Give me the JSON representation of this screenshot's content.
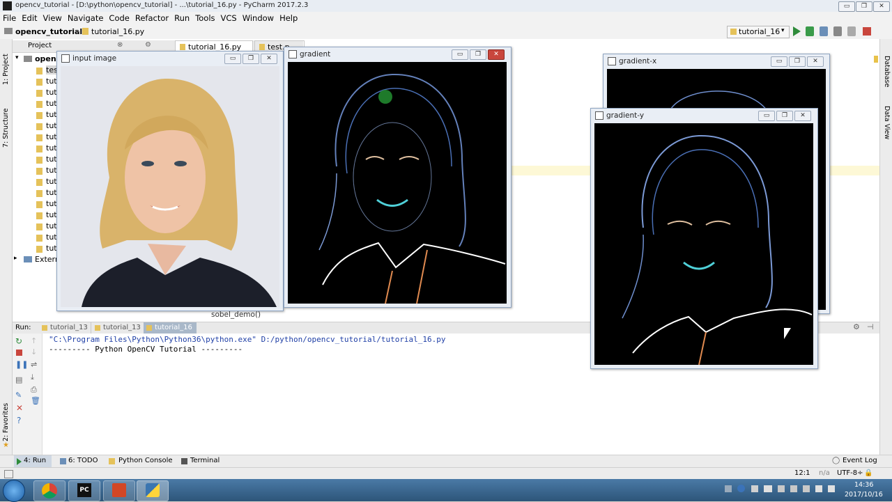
{
  "window": {
    "title": "opencv_tutorial - [D:\\python\\opencv_tutorial] - ...\\tutorial_16.py - PyCharm 2017.2.3",
    "min": "▭",
    "max": "❐",
    "close": "✕"
  },
  "menu": [
    "File",
    "Edit",
    "View",
    "Navigate",
    "Code",
    "Refactor",
    "Run",
    "Tools",
    "VCS",
    "Window",
    "Help"
  ],
  "nav": {
    "project": "opencv_tutorial",
    "file": "tutorial_16.py",
    "run_config": "tutorial_16"
  },
  "side": {
    "project_tab": "1: Project",
    "structure_tab": "7: Structure",
    "favorites_tab": "2: Favorites",
    "database_tab": "Database",
    "dataview_tab": "Data View"
  },
  "project_panel": {
    "header": "Project",
    "root": "openc",
    "items": [
      "tes",
      "tuto",
      "tuto",
      "tuto",
      "tuto",
      "tuto",
      "tuto",
      "tuto",
      "tuto",
      "tuto",
      "tuto",
      "tuto",
      "tuto",
      "tuto",
      "tuto",
      "tuto",
      "tuto"
    ],
    "external": "Extern"
  },
  "editor": {
    "tabs": [
      "tutorial_16.py",
      "test.p"
    ],
    "breadcrumb": "sobel_demo()"
  },
  "run_panel": {
    "label": "Run:",
    "tabs": [
      "tutorial_13",
      "tutorial_13",
      "tutorial_16"
    ],
    "lines": [
      "\"C:\\Program Files\\Python\\Python36\\python.exe\" D:/python/opencv_tutorial/tutorial_16.py",
      "--------- Python OpenCV Tutorial ---------"
    ]
  },
  "bottom_tools": {
    "run": "4: Run",
    "todo": "6: TODO",
    "console": "Python Console",
    "terminal": "Terminal",
    "event_log": "Event Log"
  },
  "status": {
    "position": "12:1",
    "na": "n/a",
    "encoding": "UTF-8÷"
  },
  "cv_windows": {
    "input": "input image",
    "gradient": "gradient",
    "gradient_x": "gradient-x",
    "gradient_y": "gradient-y"
  },
  "clock": {
    "time": "14:36",
    "date": "2017/10/16"
  },
  "colors": {
    "accent": "#3b73b9",
    "run_green": "#2e8b3a",
    "close_red": "#c9463d"
  }
}
